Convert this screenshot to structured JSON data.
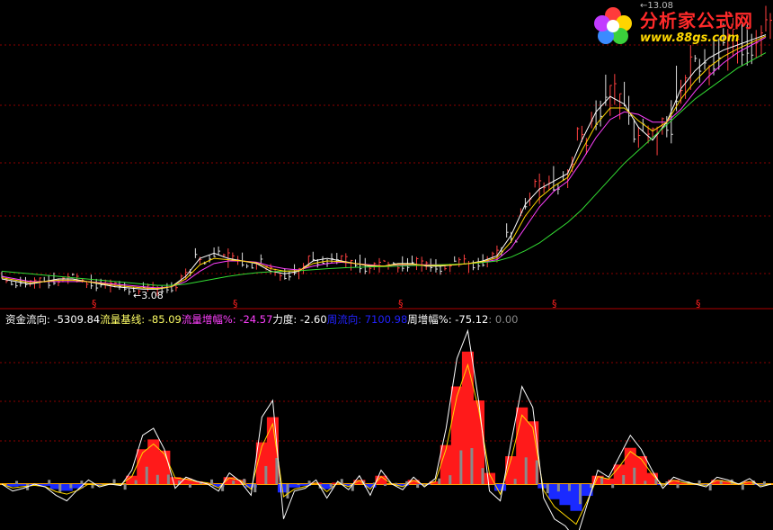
{
  "logo": {
    "title": "分析家公式网",
    "url": "www.88gs.com",
    "flower_colors": [
      "#ff3b3b",
      "#ffd400",
      "#3bd13b",
      "#3b8bff",
      "#c23bff"
    ]
  },
  "price_panel": {
    "low_marker": "←3.08",
    "top_price_label": "13.08",
    "dividend_marker": "§",
    "colors": {
      "up_bar": "#ff4040",
      "down_bar": "#e0e0e0",
      "ma_fast": "#ffffff",
      "ma_mid": "#ffd700",
      "ma_slow": "#ff40ff",
      "ma_long": "#33dd33",
      "grid": "#8b0000"
    }
  },
  "indicator_bar": {
    "items": [
      {
        "label": "资金流向:",
        "value": "-5309.84",
        "color": "#ffffff"
      },
      {
        "label": "流量基线:",
        "value": "-85.09",
        "color": "#ffff66"
      },
      {
        "label": "流量增幅%:",
        "value": "-24.57",
        "color": "#ff40ff"
      },
      {
        "label": "力度:",
        "value": "-2.60",
        "color": "#ffffff"
      },
      {
        "label": "周流向:",
        "value": "7100.98",
        "color": "#2222ff"
      },
      {
        "label": "周增幅%:",
        "value": "-75.12",
        "color": "#ffffff"
      },
      {
        "label": ":",
        "value": "0.00",
        "color": "#888888"
      }
    ]
  },
  "chart_data": [
    {
      "type": "candlestick",
      "description_role": "price",
      "annotations": [
        "←3.08",
        "13.08"
      ],
      "markers": [
        "§",
        "§",
        "§",
        "§",
        "§"
      ],
      "series": [
        {
          "name": "MA-fast",
          "values": [
            3.5,
            3.4,
            3.3,
            3.4,
            3.5,
            3.5,
            3.4,
            3.3,
            3.2,
            3.15,
            3.1,
            3.1,
            3.2,
            3.6,
            4.3,
            4.5,
            4.3,
            4.2,
            4.1,
            3.8,
            3.7,
            3.8,
            4.2,
            4.3,
            4.2,
            4.1,
            4.0,
            4.0,
            4.1,
            4.1,
            4.0,
            4.0,
            4.05,
            4.1,
            4.2,
            4.4,
            5.2,
            6.4,
            7.0,
            7.3,
            7.6,
            8.9,
            10.0,
            10.6,
            10.3,
            9.4,
            8.9,
            9.6,
            10.9,
            11.6,
            12.1,
            12.4,
            12.6,
            12.8,
            13.0
          ]
        },
        {
          "name": "MA-slow",
          "values": [
            3.6,
            3.5,
            3.4,
            3.4,
            3.4,
            3.4,
            3.4,
            3.35,
            3.3,
            3.25,
            3.2,
            3.15,
            3.2,
            3.4,
            3.8,
            4.1,
            4.2,
            4.2,
            4.15,
            4.0,
            3.9,
            3.85,
            4.0,
            4.1,
            4.15,
            4.1,
            4.05,
            4.0,
            4.05,
            4.05,
            4.05,
            4.05,
            4.05,
            4.1,
            4.15,
            4.25,
            4.7,
            5.5,
            6.3,
            6.9,
            7.3,
            8.1,
            9.0,
            9.7,
            10.0,
            9.9,
            9.6,
            9.6,
            10.1,
            10.8,
            11.4,
            11.9,
            12.3,
            12.6,
            12.9
          ]
        },
        {
          "name": "MA-long",
          "values": [
            3.8,
            3.75,
            3.7,
            3.65,
            3.6,
            3.55,
            3.5,
            3.45,
            3.4,
            3.35,
            3.3,
            3.25,
            3.25,
            3.3,
            3.4,
            3.5,
            3.6,
            3.68,
            3.74,
            3.78,
            3.8,
            3.82,
            3.86,
            3.9,
            3.93,
            3.95,
            3.97,
            3.98,
            4.0,
            4.02,
            4.03,
            4.05,
            4.07,
            4.1,
            4.14,
            4.2,
            4.35,
            4.6,
            4.9,
            5.3,
            5.7,
            6.2,
            6.8,
            7.4,
            8.0,
            8.5,
            9.0,
            9.5,
            10.0,
            10.5,
            10.9,
            11.3,
            11.7,
            12.0,
            12.3
          ]
        }
      ]
    },
    {
      "type": "bar",
      "description_role": "fund-flow histogram with overlay line",
      "series": [
        {
          "name": "资金流向",
          "values": [
            0,
            -5,
            -3,
            0,
            -2,
            -8,
            -12,
            -4,
            3,
            -2,
            0,
            -1,
            10,
            35,
            40,
            25,
            -3,
            5,
            2,
            0,
            -5,
            8,
            2,
            -8,
            48,
            60,
            -25,
            -5,
            -3,
            3,
            -10,
            2,
            -4,
            6,
            -8,
            10,
            0,
            -4,
            5,
            -2,
            4,
            40,
            90,
            110,
            60,
            -5,
            -12,
            30,
            70,
            55,
            -10,
            -25,
            -30,
            -40,
            -15,
            10,
            5,
            20,
            35,
            25,
            10,
            -3,
            5,
            2,
            0,
            -2,
            5,
            3,
            0,
            4,
            -2,
            0
          ]
        },
        {
          "name": "流量基线",
          "values": [
            0,
            -3,
            -2,
            -1,
            -2,
            -6,
            -8,
            -5,
            0,
            -1,
            0,
            0,
            6,
            25,
            32,
            24,
            5,
            4,
            2,
            1,
            -3,
            5,
            3,
            -4,
            30,
            48,
            -10,
            -4,
            -2,
            1,
            -6,
            1,
            -2,
            3,
            -4,
            6,
            0,
            -2,
            3,
            -1,
            2,
            28,
            70,
            95,
            60,
            8,
            -8,
            20,
            55,
            45,
            -5,
            -18,
            -25,
            -32,
            -14,
            6,
            4,
            14,
            26,
            20,
            8,
            -1,
            3,
            1,
            0,
            -1,
            3,
            2,
            0,
            2,
            -1,
            0
          ]
        }
      ]
    }
  ]
}
